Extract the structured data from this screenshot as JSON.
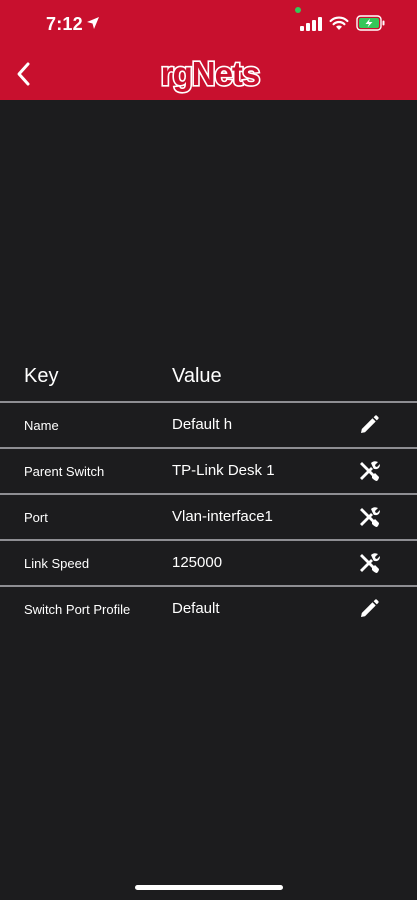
{
  "status_bar": {
    "time": "7:12"
  },
  "nav": {
    "back_icon": "chevron-left-icon",
    "logo_text": "rgNets"
  },
  "table": {
    "key_header": "Key",
    "value_header": "Value",
    "rows": [
      {
        "key": "Name",
        "value": "Default h",
        "action_icon": "pencil-icon"
      },
      {
        "key": "Parent Switch",
        "value": "TP-Link Desk 1",
        "action_icon": "tools-icon"
      },
      {
        "key": "Port",
        "value": "Vlan-interface1",
        "action_icon": "tools-icon"
      },
      {
        "key": "Link Speed",
        "value": "125000",
        "action_icon": "tools-icon"
      },
      {
        "key": "Switch Port Profile",
        "value": "Default",
        "action_icon": "pencil-icon"
      }
    ]
  },
  "colors": {
    "header_bg": "#c8102e",
    "page_bg": "#1c1c1e",
    "divider": "#8e8e93",
    "text": "#ffffff",
    "battery_charge": "#34c759"
  }
}
